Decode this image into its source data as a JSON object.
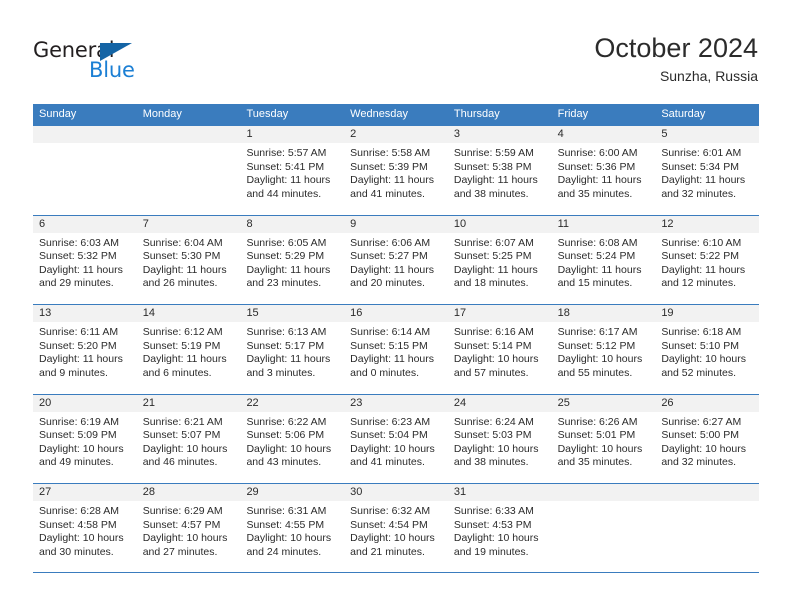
{
  "logo": {
    "primary_text": "General",
    "secondary_text": "Blue",
    "primary_color": "#231f20",
    "secondary_color": "#1b7fd4",
    "accent_color": "#1464a5"
  },
  "header": {
    "title": "October 2024",
    "subtitle": "Sunzha, Russia"
  },
  "theme": {
    "header_bg": "#3a7cbe",
    "day_band_bg": "#f2f2f2",
    "text_color": "#2b2b2b"
  },
  "weekdays": [
    "Sunday",
    "Monday",
    "Tuesday",
    "Wednesday",
    "Thursday",
    "Friday",
    "Saturday"
  ],
  "weeks": [
    [
      {
        "day": "",
        "sunrise": "",
        "sunset": "",
        "daylight_line1": "",
        "daylight_line2": ""
      },
      {
        "day": "",
        "sunrise": "",
        "sunset": "",
        "daylight_line1": "",
        "daylight_line2": ""
      },
      {
        "day": "1",
        "sunrise": "Sunrise: 5:57 AM",
        "sunset": "Sunset: 5:41 PM",
        "daylight_line1": "Daylight: 11 hours",
        "daylight_line2": "and 44 minutes."
      },
      {
        "day": "2",
        "sunrise": "Sunrise: 5:58 AM",
        "sunset": "Sunset: 5:39 PM",
        "daylight_line1": "Daylight: 11 hours",
        "daylight_line2": "and 41 minutes."
      },
      {
        "day": "3",
        "sunrise": "Sunrise: 5:59 AM",
        "sunset": "Sunset: 5:38 PM",
        "daylight_line1": "Daylight: 11 hours",
        "daylight_line2": "and 38 minutes."
      },
      {
        "day": "4",
        "sunrise": "Sunrise: 6:00 AM",
        "sunset": "Sunset: 5:36 PM",
        "daylight_line1": "Daylight: 11 hours",
        "daylight_line2": "and 35 minutes."
      },
      {
        "day": "5",
        "sunrise": "Sunrise: 6:01 AM",
        "sunset": "Sunset: 5:34 PM",
        "daylight_line1": "Daylight: 11 hours",
        "daylight_line2": "and 32 minutes."
      }
    ],
    [
      {
        "day": "6",
        "sunrise": "Sunrise: 6:03 AM",
        "sunset": "Sunset: 5:32 PM",
        "daylight_line1": "Daylight: 11 hours",
        "daylight_line2": "and 29 minutes."
      },
      {
        "day": "7",
        "sunrise": "Sunrise: 6:04 AM",
        "sunset": "Sunset: 5:30 PM",
        "daylight_line1": "Daylight: 11 hours",
        "daylight_line2": "and 26 minutes."
      },
      {
        "day": "8",
        "sunrise": "Sunrise: 6:05 AM",
        "sunset": "Sunset: 5:29 PM",
        "daylight_line1": "Daylight: 11 hours",
        "daylight_line2": "and 23 minutes."
      },
      {
        "day": "9",
        "sunrise": "Sunrise: 6:06 AM",
        "sunset": "Sunset: 5:27 PM",
        "daylight_line1": "Daylight: 11 hours",
        "daylight_line2": "and 20 minutes."
      },
      {
        "day": "10",
        "sunrise": "Sunrise: 6:07 AM",
        "sunset": "Sunset: 5:25 PM",
        "daylight_line1": "Daylight: 11 hours",
        "daylight_line2": "and 18 minutes."
      },
      {
        "day": "11",
        "sunrise": "Sunrise: 6:08 AM",
        "sunset": "Sunset: 5:24 PM",
        "daylight_line1": "Daylight: 11 hours",
        "daylight_line2": "and 15 minutes."
      },
      {
        "day": "12",
        "sunrise": "Sunrise: 6:10 AM",
        "sunset": "Sunset: 5:22 PM",
        "daylight_line1": "Daylight: 11 hours",
        "daylight_line2": "and 12 minutes."
      }
    ],
    [
      {
        "day": "13",
        "sunrise": "Sunrise: 6:11 AM",
        "sunset": "Sunset: 5:20 PM",
        "daylight_line1": "Daylight: 11 hours",
        "daylight_line2": "and 9 minutes."
      },
      {
        "day": "14",
        "sunrise": "Sunrise: 6:12 AM",
        "sunset": "Sunset: 5:19 PM",
        "daylight_line1": "Daylight: 11 hours",
        "daylight_line2": "and 6 minutes."
      },
      {
        "day": "15",
        "sunrise": "Sunrise: 6:13 AM",
        "sunset": "Sunset: 5:17 PM",
        "daylight_line1": "Daylight: 11 hours",
        "daylight_line2": "and 3 minutes."
      },
      {
        "day": "16",
        "sunrise": "Sunrise: 6:14 AM",
        "sunset": "Sunset: 5:15 PM",
        "daylight_line1": "Daylight: 11 hours",
        "daylight_line2": "and 0 minutes."
      },
      {
        "day": "17",
        "sunrise": "Sunrise: 6:16 AM",
        "sunset": "Sunset: 5:14 PM",
        "daylight_line1": "Daylight: 10 hours",
        "daylight_line2": "and 57 minutes."
      },
      {
        "day": "18",
        "sunrise": "Sunrise: 6:17 AM",
        "sunset": "Sunset: 5:12 PM",
        "daylight_line1": "Daylight: 10 hours",
        "daylight_line2": "and 55 minutes."
      },
      {
        "day": "19",
        "sunrise": "Sunrise: 6:18 AM",
        "sunset": "Sunset: 5:10 PM",
        "daylight_line1": "Daylight: 10 hours",
        "daylight_line2": "and 52 minutes."
      }
    ],
    [
      {
        "day": "20",
        "sunrise": "Sunrise: 6:19 AM",
        "sunset": "Sunset: 5:09 PM",
        "daylight_line1": "Daylight: 10 hours",
        "daylight_line2": "and 49 minutes."
      },
      {
        "day": "21",
        "sunrise": "Sunrise: 6:21 AM",
        "sunset": "Sunset: 5:07 PM",
        "daylight_line1": "Daylight: 10 hours",
        "daylight_line2": "and 46 minutes."
      },
      {
        "day": "22",
        "sunrise": "Sunrise: 6:22 AM",
        "sunset": "Sunset: 5:06 PM",
        "daylight_line1": "Daylight: 10 hours",
        "daylight_line2": "and 43 minutes."
      },
      {
        "day": "23",
        "sunrise": "Sunrise: 6:23 AM",
        "sunset": "Sunset: 5:04 PM",
        "daylight_line1": "Daylight: 10 hours",
        "daylight_line2": "and 41 minutes."
      },
      {
        "day": "24",
        "sunrise": "Sunrise: 6:24 AM",
        "sunset": "Sunset: 5:03 PM",
        "daylight_line1": "Daylight: 10 hours",
        "daylight_line2": "and 38 minutes."
      },
      {
        "day": "25",
        "sunrise": "Sunrise: 6:26 AM",
        "sunset": "Sunset: 5:01 PM",
        "daylight_line1": "Daylight: 10 hours",
        "daylight_line2": "and 35 minutes."
      },
      {
        "day": "26",
        "sunrise": "Sunrise: 6:27 AM",
        "sunset": "Sunset: 5:00 PM",
        "daylight_line1": "Daylight: 10 hours",
        "daylight_line2": "and 32 minutes."
      }
    ],
    [
      {
        "day": "27",
        "sunrise": "Sunrise: 6:28 AM",
        "sunset": "Sunset: 4:58 PM",
        "daylight_line1": "Daylight: 10 hours",
        "daylight_line2": "and 30 minutes."
      },
      {
        "day": "28",
        "sunrise": "Sunrise: 6:29 AM",
        "sunset": "Sunset: 4:57 PM",
        "daylight_line1": "Daylight: 10 hours",
        "daylight_line2": "and 27 minutes."
      },
      {
        "day": "29",
        "sunrise": "Sunrise: 6:31 AM",
        "sunset": "Sunset: 4:55 PM",
        "daylight_line1": "Daylight: 10 hours",
        "daylight_line2": "and 24 minutes."
      },
      {
        "day": "30",
        "sunrise": "Sunrise: 6:32 AM",
        "sunset": "Sunset: 4:54 PM",
        "daylight_line1": "Daylight: 10 hours",
        "daylight_line2": "and 21 minutes."
      },
      {
        "day": "31",
        "sunrise": "Sunrise: 6:33 AM",
        "sunset": "Sunset: 4:53 PM",
        "daylight_line1": "Daylight: 10 hours",
        "daylight_line2": "and 19 minutes."
      },
      {
        "day": "",
        "sunrise": "",
        "sunset": "",
        "daylight_line1": "",
        "daylight_line2": ""
      },
      {
        "day": "",
        "sunrise": "",
        "sunset": "",
        "daylight_line1": "",
        "daylight_line2": ""
      }
    ]
  ]
}
